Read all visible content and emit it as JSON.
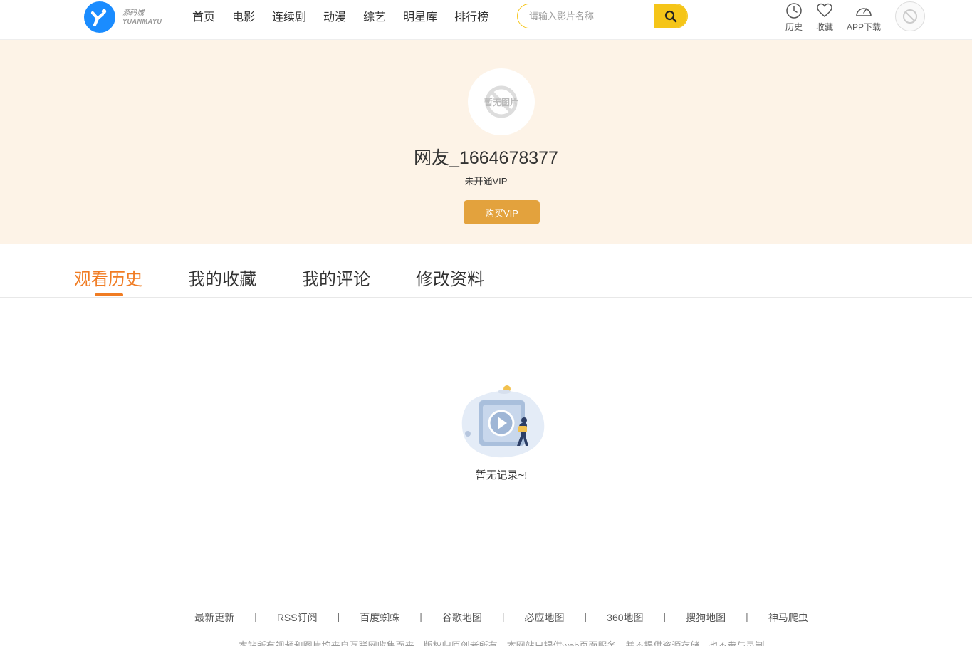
{
  "header": {
    "logo_cn": "源码城",
    "logo_en": "YUANMAYU",
    "nav": [
      "首页",
      "电影",
      "连续剧",
      "动漫",
      "综艺",
      "明星库",
      "排行榜"
    ],
    "search_placeholder": "请输入影片名称",
    "tools": {
      "history": "历史",
      "favorites": "收藏",
      "app": "APP下载"
    }
  },
  "profile": {
    "avatar_placeholder": "暂无图片",
    "username": "网友_1664678377",
    "vip_status": "未开通VIP",
    "buy_vip": "购买VIP"
  },
  "tabs": [
    "观看历史",
    "我的收藏",
    "我的评论",
    "修改资料"
  ],
  "active_tab": "观看历史",
  "empty": {
    "text": "暂无记录~!"
  },
  "footer": {
    "links": [
      "最新更新",
      "RSS订阅",
      "百度蜘蛛",
      "谷歌地图",
      "必应地图",
      "360地图",
      "搜狗地图",
      "神马爬虫"
    ],
    "separator": "|",
    "note": "本站所有视频和图片均来自互联网收集而来，版权归原创者所有，本网站只提供web页面服务，并不提供资源存储，也不参与录制"
  },
  "colors": {
    "accent": "#f07c23",
    "search": "#f5c518",
    "vip_button": "#e3a23d",
    "banner_bg": "#fdf3e7",
    "logo": "#1a8cff"
  }
}
